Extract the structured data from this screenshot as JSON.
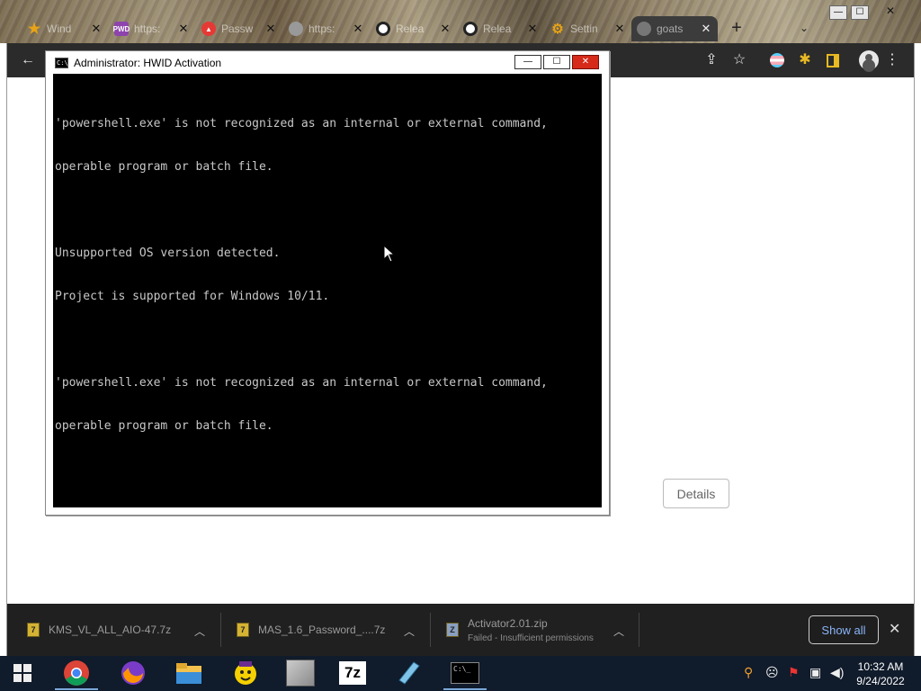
{
  "browser": {
    "tabs": [
      {
        "label": "Wind",
        "favicon": "star-icon",
        "color": "#e8a317"
      },
      {
        "label": "https:",
        "favicon": "pwd-icon",
        "color": "#8e44ad",
        "badge": "PWD"
      },
      {
        "label": "Passw",
        "favicon": "bitwarden-icon",
        "color": "#e53935"
      },
      {
        "label": "https:",
        "favicon": "loading-icon",
        "color": "#999999"
      },
      {
        "label": "Relea",
        "favicon": "github-icon",
        "color": "#ffffff"
      },
      {
        "label": "Relea",
        "favicon": "github-icon",
        "color": "#ffffff"
      },
      {
        "label": "Settin",
        "favicon": "gear-icon",
        "color": "#e8a317"
      },
      {
        "label": "goats",
        "favicon": "goat-icon",
        "color": "#777777",
        "active": true
      }
    ],
    "new_tab": "+",
    "tab_search": "⌄"
  },
  "window_controls": {
    "minimize": "—",
    "maximize": "☐",
    "close": "✕"
  },
  "toolbar": {
    "back": "←",
    "share": "⇪",
    "bookmark": "☆",
    "menu": "⋮"
  },
  "page": {
    "details_button": "Details"
  },
  "console": {
    "icon_text": "C:\\_",
    "title": "Administrator:  HWID Activation",
    "minimize": "—",
    "maximize": "☐",
    "close": "✕",
    "lines": [
      "'powershell.exe' is not recognized as an internal or external command,",
      "operable program or batch file.",
      "",
      "Unsupported OS version detected.",
      "Project is supported for Windows 10/11.",
      "",
      "'powershell.exe' is not recognized as an internal or external command,",
      "operable program or batch file."
    ]
  },
  "downloads": [
    {
      "name": "KMS_VL_ALL_AIO-47.7z",
      "status": ""
    },
    {
      "name": "MAS_1.6_Password_....7z",
      "status": ""
    },
    {
      "name": "Activator2.01.zip",
      "status": "Failed - Insufficient permissions"
    }
  ],
  "download_shelf": {
    "show_all": "Show all",
    "close": "✕"
  },
  "taskbar": {
    "clock_time": "10:32 AM",
    "clock_date": "9/24/2022",
    "apps": [
      "windows-start-icon",
      "chrome-icon",
      "firefox-icon",
      "file-explorer-icon",
      "yahoo-messenger-icon",
      "cat-photo-icon",
      "7zip-icon",
      "notepad-icon",
      "cmd-icon"
    ],
    "sevenzip_label": "7z",
    "cmd_label": "C:\\_"
  }
}
